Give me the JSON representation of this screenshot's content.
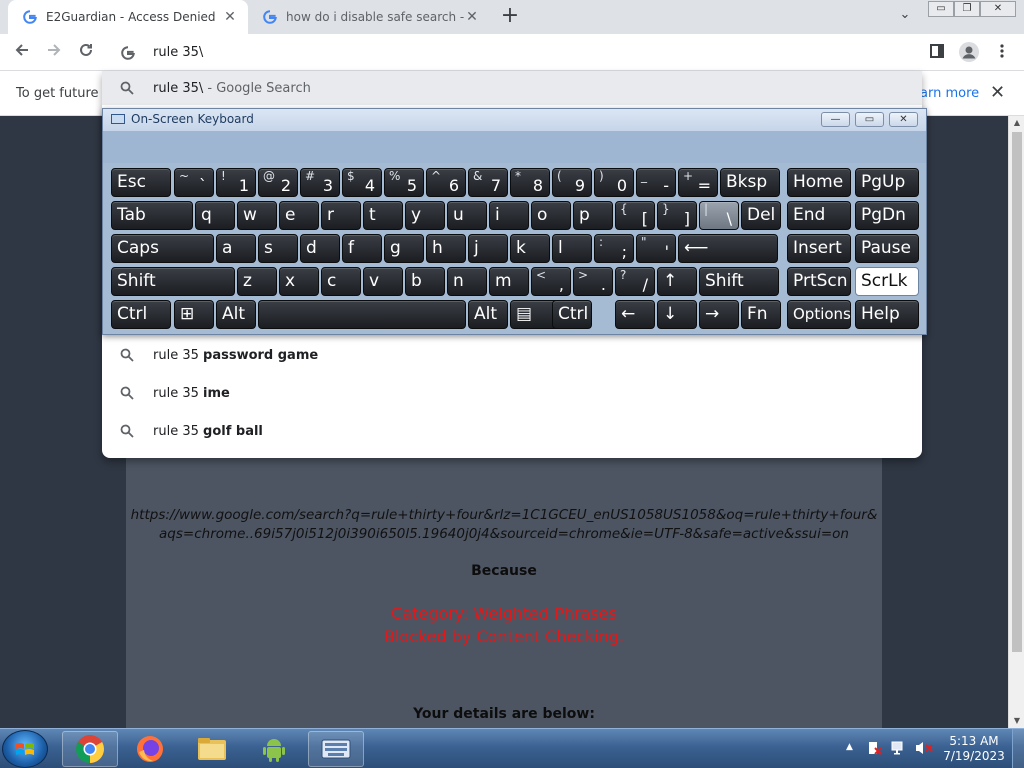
{
  "browser": {
    "tabs": [
      {
        "title": "E2Guardian - Access Denied",
        "active": true
      },
      {
        "title": "how do i disable safe search - Go",
        "active": false
      }
    ],
    "new_tab": "+",
    "tab_search": "⌄",
    "close_glyph": "✕",
    "window_controls": {
      "minimize": "▭",
      "maximize": "❐",
      "close": "✕"
    },
    "omnibox_value": "rule 35\\"
  },
  "infobar": {
    "text": "To get future G",
    "link": "earn more",
    "close": "✕"
  },
  "dropdown": {
    "first": {
      "query": "rule 35\\",
      "suffix": " - Google Search"
    },
    "suggestions": [
      {
        "prefix": "rule 35 ",
        "bold": "password game"
      },
      {
        "prefix": "rule 35 ",
        "bold": "ime"
      },
      {
        "prefix": "rule 35 ",
        "bold": "golf ball"
      }
    ]
  },
  "page": {
    "url": "https://www.google.com/search?q=rule+thirty+four&rlz=1C1GCEU_enUS1058US1058&oq=rule+thirty+four&aqs=chrome..69i57j0i512j0i390i650l5.19640j0j4&sourceid=chrome&ie=UTF-8&safe=active&ssui=on",
    "because": "Because",
    "reason_line1": "Category: Weighted Phrases",
    "reason_line2": "Blocked by Content Checking.",
    "details": "Your details are below:"
  },
  "osk": {
    "title": "On-Screen Keyboard",
    "controls": {
      "minimize": "—",
      "restore": "▭",
      "close": "✕"
    },
    "rows": [
      [
        {
          "label": "Esc"
        },
        {
          "shift": "~",
          "main": "`"
        },
        {
          "shift": "!",
          "main": "1"
        },
        {
          "shift": "@",
          "main": "2"
        },
        {
          "shift": "#",
          "main": "3"
        },
        {
          "shift": "$",
          "main": "4"
        },
        {
          "shift": "%",
          "main": "5"
        },
        {
          "shift": "^",
          "main": "6"
        },
        {
          "shift": "&",
          "main": "7"
        },
        {
          "shift": "*",
          "main": "8"
        },
        {
          "shift": "(",
          "main": "9"
        },
        {
          "shift": ")",
          "main": "0"
        },
        {
          "shift": "_",
          "main": "-"
        },
        {
          "shift": "+",
          "main": "="
        },
        {
          "label": "Bksp"
        },
        {
          "label": "Home"
        },
        {
          "label": "PgUp"
        }
      ],
      [
        {
          "label": "Tab"
        },
        {
          "label": "q"
        },
        {
          "label": "w"
        },
        {
          "label": "e"
        },
        {
          "label": "r"
        },
        {
          "label": "t"
        },
        {
          "label": "y"
        },
        {
          "label": "u"
        },
        {
          "label": "i"
        },
        {
          "label": "o"
        },
        {
          "label": "p"
        },
        {
          "shift": "{",
          "main": "["
        },
        {
          "shift": "}",
          "main": "]"
        },
        {
          "shift": "|",
          "main": "\\"
        },
        {
          "label": "Del"
        },
        {
          "label": "End"
        },
        {
          "label": "PgDn"
        }
      ],
      [
        {
          "label": "Caps"
        },
        {
          "label": "a"
        },
        {
          "label": "s"
        },
        {
          "label": "d"
        },
        {
          "label": "f"
        },
        {
          "label": "g"
        },
        {
          "label": "h"
        },
        {
          "label": "j"
        },
        {
          "label": "k"
        },
        {
          "label": "l"
        },
        {
          "shift": ":",
          "main": ";"
        },
        {
          "shift": "\"",
          "main": "'"
        },
        {
          "label": "⟵"
        },
        {
          "label": "Insert"
        },
        {
          "label": "Pause"
        }
      ],
      [
        {
          "label": "Shift"
        },
        {
          "label": "z"
        },
        {
          "label": "x"
        },
        {
          "label": "c"
        },
        {
          "label": "v"
        },
        {
          "label": "b"
        },
        {
          "label": "n"
        },
        {
          "label": "m"
        },
        {
          "shift": "<",
          "main": ","
        },
        {
          "shift": ">",
          "main": "."
        },
        {
          "shift": "?",
          "main": "/"
        },
        {
          "label": "↑"
        },
        {
          "label": "Shift"
        },
        {
          "label": "PrtScn"
        },
        {
          "label": "ScrLk"
        }
      ],
      [
        {
          "label": "Ctrl"
        },
        {
          "label": "⊞"
        },
        {
          "label": "Alt"
        },
        {
          "label": ""
        },
        {
          "label": "Alt"
        },
        {
          "label": "▤"
        },
        {
          "label": "Ctrl"
        },
        {
          "label": "←"
        },
        {
          "label": "↓"
        },
        {
          "label": "→"
        },
        {
          "label": "Fn"
        },
        {
          "label": "Options"
        },
        {
          "label": "Help"
        }
      ]
    ]
  },
  "taskbar": {
    "clock_time": "5:13 AM",
    "clock_date": "7/19/2023",
    "tray_arrow": "▲"
  },
  "colors": {
    "page_bg": "#2f3744",
    "panel_bg": "#4d5563",
    "reason_text": "#e0191a",
    "osk_bg": "#a9bdd4",
    "taskbar": "#3b6292"
  }
}
